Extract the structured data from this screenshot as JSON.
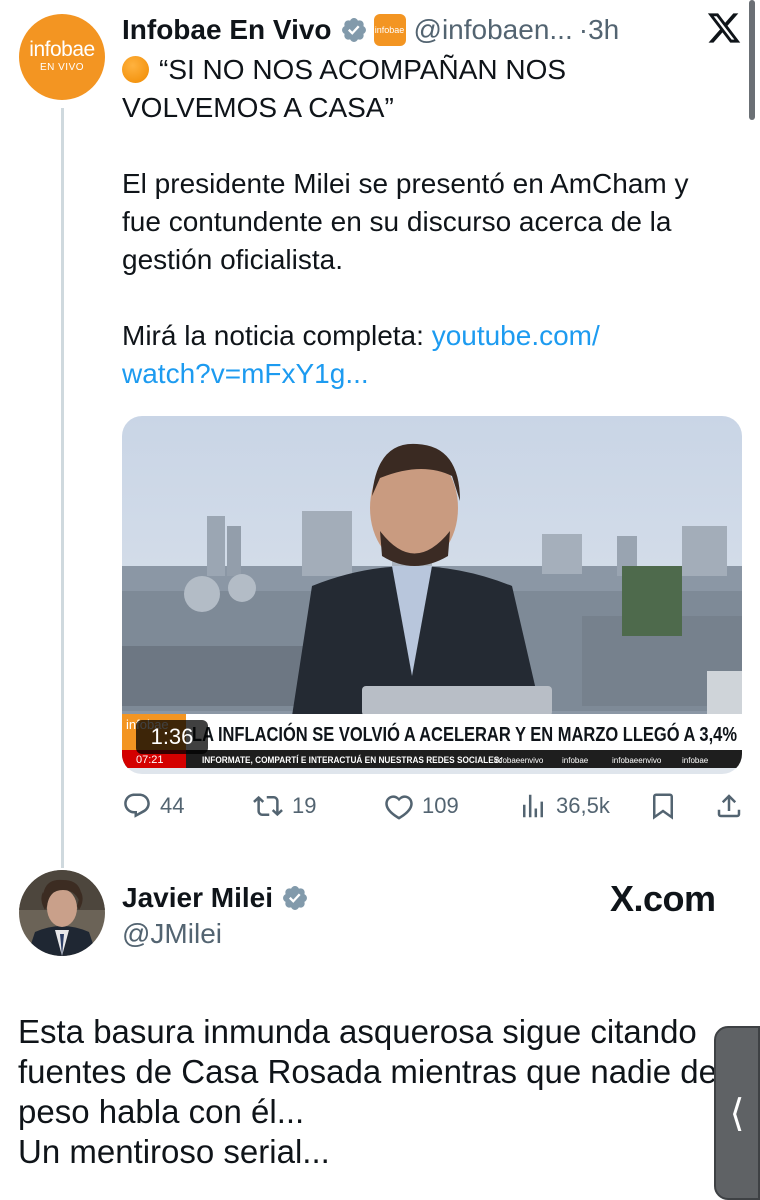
{
  "tweet1": {
    "avatar": {
      "brand": "infobae",
      "sub": "EN VIVO"
    },
    "name": "Infobae En Vivo",
    "affiliate_badge": "infobae",
    "handle": "@infobaen...",
    "separator": "·",
    "time": "3h",
    "text": {
      "headline_line1": "“SI NO NOS ACOMPAÑAN NOS",
      "headline_line2": "VOLVEMOS A CASA”",
      "body_line1": "El presidente Milei se presentó en AmCham y",
      "body_line2": "fue contundente en su discurso acerca de la",
      "body_line3": "gestión oficialista.",
      "cta_prefix": "Mirá la noticia completa: ",
      "link_part1": "youtube.com/",
      "link_part2": "watch?v=mFxY1g..."
    },
    "video": {
      "duration": "1:36",
      "chyron": "LA INFLACIÓN SE VOLVIÓ A ACELERAR Y EN MARZO LLEGÓ A 3,4%",
      "chyron_logo": "infobae",
      "clock": "07:21",
      "ticker": "INFORMATE, COMPARTÍ E INTERACTUÁ EN NUESTRAS REDES SOCIALES:",
      "socials": [
        "infobaeenvivo",
        "infobae",
        "infobaeenvivo",
        "infobae"
      ]
    },
    "actions": {
      "replies": "44",
      "reposts": "19",
      "likes": "109",
      "views": "36,5k"
    }
  },
  "tweet2": {
    "name": "Javier Milei",
    "handle": "@JMilei",
    "watermark": "X.com",
    "text": {
      "line1": "Esta basura inmunda asquerosa sigue citando",
      "line2": "fuentes de Casa Rosada mientras que nadie de",
      "line3": "peso habla con él...",
      "line4": "Un mentiroso serial..."
    }
  },
  "side_tab": {
    "glyph": "⟨"
  },
  "colors": {
    "link": "#1d9bf0",
    "muted": "#536471",
    "verified": "#829aab",
    "infobae_orange": "#f39522",
    "chyron_red": "#d40000"
  },
  "icons": [
    "verified-icon",
    "x-logo-icon",
    "reply-icon",
    "repost-icon",
    "like-icon",
    "views-icon",
    "bookmark-icon",
    "share-icon"
  ]
}
